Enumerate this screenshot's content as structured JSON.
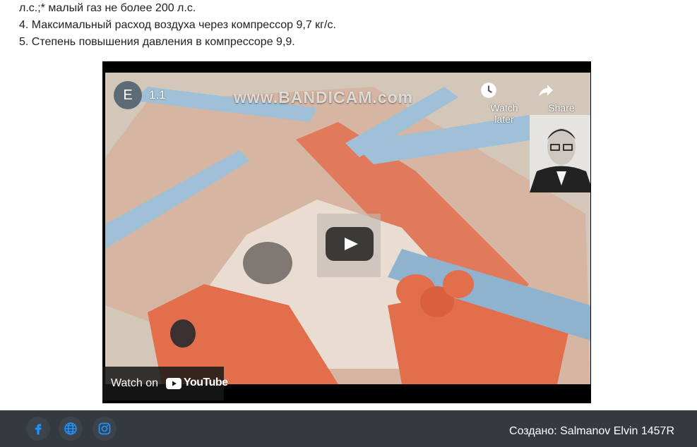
{
  "text": {
    "line1": "л.с.;* малый газ не более 200 л.с.",
    "line2": "4. Максимальный расход воздуха через компрессор 9,7 кг/с.",
    "line3": "5. Степень повышения давления в компрессоре 9,9."
  },
  "video": {
    "channel_initial": "E",
    "title": "1.1",
    "watermark": "www.BANDICAM.com",
    "watch_later_label": "Watch later",
    "share_label": "Share",
    "watch_on_label": "Watch on",
    "youtube_wordmark": "YouTube"
  },
  "footer": {
    "credit": "Создано: Salmanov Elvin 1457R"
  },
  "colors": {
    "footer_bg": "#343a40",
    "social_icon": "#1e90ff",
    "play_bg": "#212121",
    "youtube_red": "#ff0000"
  },
  "icons": [
    "facebook-icon",
    "globe-icon",
    "instagram-icon",
    "clock-icon",
    "share-arrow-icon",
    "play-icon",
    "youtube-logo-icon"
  ]
}
